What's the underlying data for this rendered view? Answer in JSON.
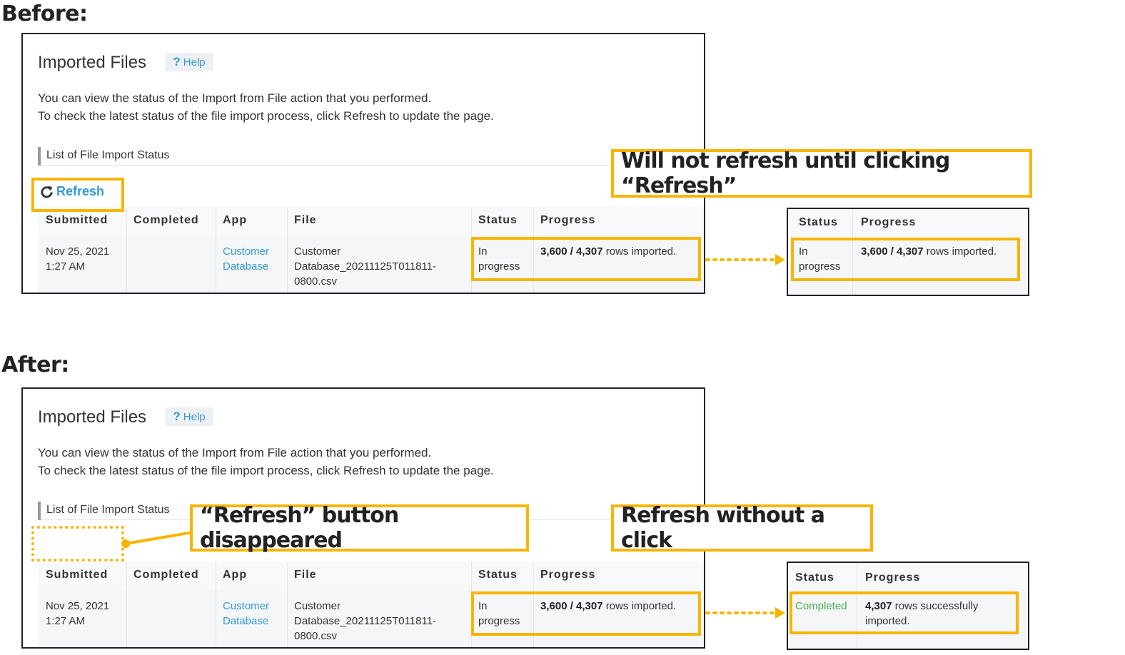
{
  "before": {
    "label": "Before:",
    "panel": {
      "title": "Imported Files",
      "help": "Help",
      "desc1": "You can view the status of the Import from File action that you performed.",
      "desc2": "To check the latest status of the file import process, click Refresh to update the page.",
      "subheading": "List of File Import Status",
      "refresh": "Refresh",
      "headers": [
        "Submitted",
        "Completed",
        "App",
        "File",
        "Status",
        "Progress"
      ],
      "row": {
        "submitted": [
          "Nov 25, 2021",
          "1:27 AM"
        ],
        "completed": "",
        "app": [
          "Customer",
          "Database"
        ],
        "file": [
          "Customer",
          "Database_20211125T011811-",
          "0800.csv"
        ],
        "status": [
          "In",
          "progress"
        ],
        "progress_bold": "3,600 / 4,307",
        "progress_rest": " rows imported."
      }
    },
    "callout": "Will not refresh until clicking “Refresh”",
    "mini": {
      "headers": [
        "Status",
        "Progress"
      ],
      "status": [
        "In",
        "progress"
      ],
      "progress_bold": "3,600 / 4,307",
      "progress_rest": " rows imported."
    }
  },
  "after": {
    "label": "After:",
    "panel": {
      "title": "Imported Files",
      "help": "Help",
      "desc1": "You can view the status of the Import from File action that you performed.",
      "desc2": "To check the latest status of the file import process, click Refresh to update the page.",
      "subheading": "List of File Import Status",
      "headers": [
        "Submitted",
        "Completed",
        "App",
        "File",
        "Status",
        "Progress"
      ],
      "row": {
        "submitted": [
          "Nov 25, 2021",
          "1:27 AM"
        ],
        "completed": "",
        "app": [
          "Customer",
          "Database"
        ],
        "file": [
          "Customer",
          "Database_20211125T011811-",
          "0800.csv"
        ],
        "status": [
          "In",
          "progress"
        ],
        "progress_bold": "3,600 / 4,307",
        "progress_rest": " rows imported."
      }
    },
    "callout_left": "“Refresh” button disappeared",
    "callout_right": "Refresh without a click",
    "mini": {
      "headers": [
        "Status",
        "Progress"
      ],
      "status": "Completed",
      "progress_bold": "4,307",
      "progress_rest": " rows successfully",
      "progress_line2": "imported."
    }
  },
  "colors": {
    "highlight": "#f7b500",
    "link": "#3498db",
    "success": "#4caf50"
  },
  "icons": {
    "refresh": "refresh-icon",
    "help": "question-mark-icon",
    "arrow": "dotted-arrow-right"
  }
}
